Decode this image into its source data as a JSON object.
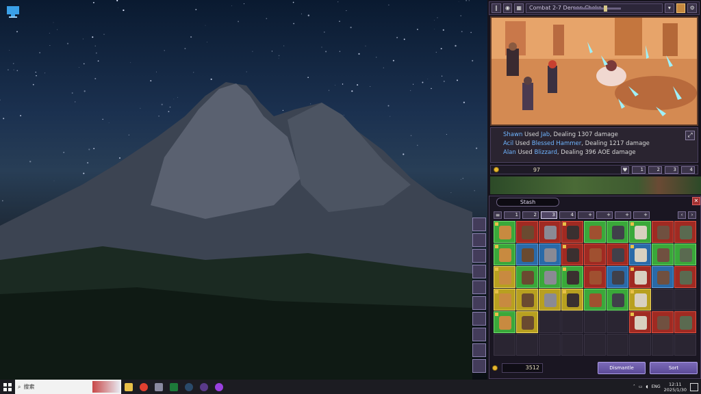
{
  "combat": {
    "title": "Combat 2-7 Demon Choke"
  },
  "battle_log": [
    {
      "actor": "Shawn",
      "verb": "Used",
      "skill": "Jab",
      "rest": ", Dealing 1307 damage"
    },
    {
      "actor": "Acil",
      "verb": "Used",
      "skill": "Blessed Hammer",
      "rest": ", Dealing 1217 damage"
    },
    {
      "actor": "Alan",
      "verb": "Used",
      "skill": "Blizzard",
      "rest": ", Dealing 396 AOE damage"
    }
  ],
  "party_bar": {
    "gold": "97",
    "slots": [
      "1",
      "2",
      "3",
      "4"
    ]
  },
  "stash": {
    "title": "Stash",
    "tabs": [
      "1",
      "2",
      "3",
      "4",
      "+",
      "+",
      "+",
      "+"
    ],
    "active_tab": 2,
    "gold": "3512",
    "dismantle_label": "Dismantle",
    "sort_label": "Sort"
  },
  "taskbar": {
    "search_placeholder": "搜索",
    "time": "12:11",
    "date": "2025/1/30",
    "ime": "ENG"
  },
  "colors": {
    "accent": "#7b6ab8",
    "log_name": "#6fb5ff",
    "rarity_green": "#3aa83a",
    "rarity_red": "#a02a22",
    "rarity_blue": "#2a6aa8",
    "rarity_yellow": "#b8a020"
  }
}
